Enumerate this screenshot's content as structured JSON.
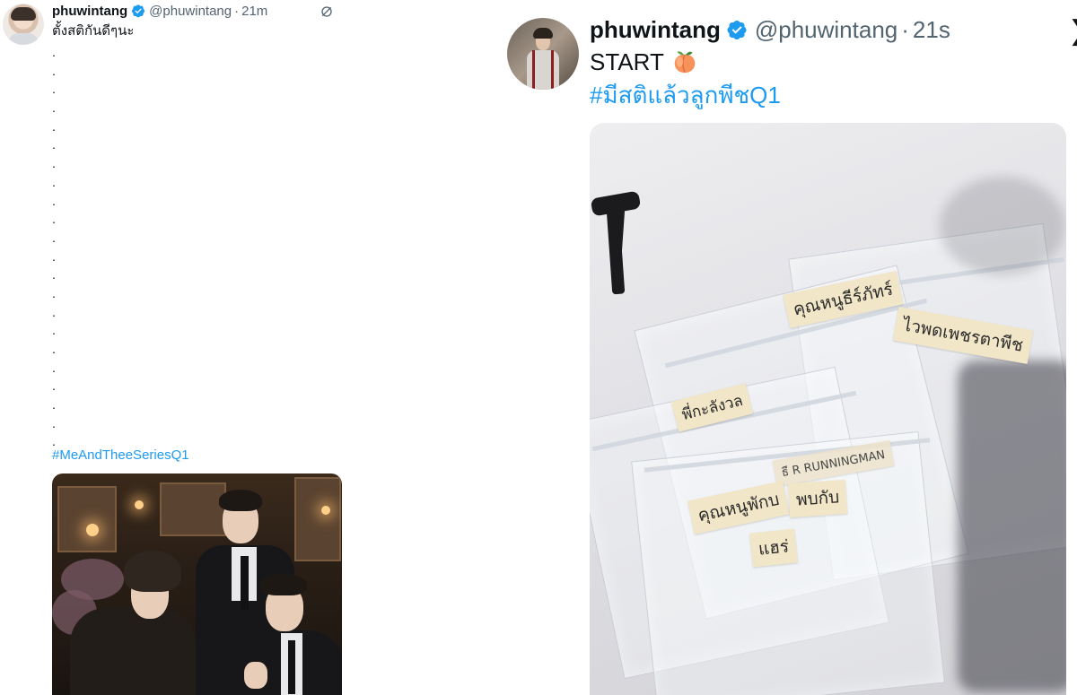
{
  "left_tweet": {
    "display_name": "phuwintang",
    "handle": "@phuwintang",
    "separator": "·",
    "time": "21m",
    "text": "ตั้งสติกันดีๆนะ",
    "dot_lines": [
      ".",
      ".",
      ".",
      ".",
      ".",
      ".",
      ".",
      ".",
      ".",
      ".",
      ".",
      ".",
      ".",
      ".",
      ".",
      ".",
      ".",
      ".",
      ".",
      ".",
      ".",
      ".",
      "."
    ],
    "hashtag": "#MeAndTheeSeriesQ1"
  },
  "right_tweet": {
    "display_name": "phuwintang",
    "handle": "@phuwintang",
    "separator": "·",
    "time": "21s",
    "text": "START",
    "emoji": "peach-emoji",
    "hashtag": "#มีสติแล้วลูกพีชQ1",
    "close_glyph": "❯",
    "photo_labels": {
      "label_1": "คุณหนูธีร์ภัทร์",
      "label_2": "ไวพดเพชรตาพีช",
      "label_3": "พี่กะลังวล",
      "label_4": "ธี R RUNNINGMAN",
      "label_5": "คุณหนูพักบ",
      "label_6": "พบกับ",
      "label_7": "แฮร่"
    }
  },
  "colors": {
    "link": "#1d9bf0",
    "text": "#0f1419",
    "muted": "#536471",
    "verified": "#1d9bf0"
  }
}
